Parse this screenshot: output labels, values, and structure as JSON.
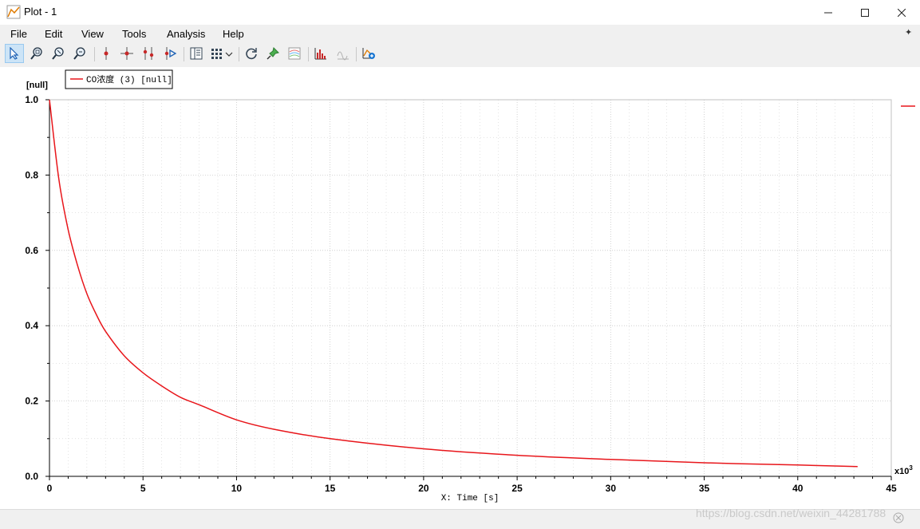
{
  "window": {
    "title": "Plot - 1"
  },
  "menu": {
    "items": [
      "File",
      "Edit",
      "View",
      "Tools",
      "Analysis",
      "Help"
    ]
  },
  "toolbar": {
    "buttons": [
      "select-tool",
      "zoom-region",
      "zoom-in",
      "zoom-out",
      "marker",
      "crosshair",
      "double-marker",
      "marker-play",
      "table-view",
      "grid-options",
      "refresh",
      "pin",
      "layers",
      "histogram",
      "fft-disabled",
      "add-plot"
    ]
  },
  "legend": {
    "label": "CO浓度 (3) [null]"
  },
  "colors": {
    "series": "#e8161b",
    "grid": "#c8c8c8"
  },
  "chart_data": {
    "type": "line",
    "xlabel": "X: Time [s]",
    "ylabel": "[null]",
    "x_multiplier_label": "x10",
    "x_multiplier_exp": "3",
    "xlim": [
      0,
      45
    ],
    "ylim": [
      0,
      1.0
    ],
    "x_ticks": [
      "0",
      "5",
      "10",
      "15",
      "20",
      "25",
      "30",
      "35",
      "40",
      "45"
    ],
    "y_ticks": [
      "0.0",
      "0.2",
      "0.4",
      "0.6",
      "0.8",
      "1.0"
    ],
    "grid": true,
    "legend_position": "top-left",
    "series": [
      {
        "name": "CO浓度 (3) [null]",
        "x": [
          0,
          0.5,
          1,
          1.5,
          2,
          2.5,
          3,
          4,
          5,
          6,
          7,
          8,
          10,
          12,
          15,
          20,
          25,
          30,
          35,
          40,
          43.2
        ],
        "y": [
          1.0,
          0.79,
          0.655,
          0.56,
          0.485,
          0.43,
          0.385,
          0.32,
          0.275,
          0.24,
          0.21,
          0.19,
          0.15,
          0.125,
          0.1,
          0.073,
          0.056,
          0.045,
          0.036,
          0.03,
          0.026
        ]
      }
    ]
  },
  "status": {
    "watermark": "https://blog.csdn.net/weixin_44281788"
  }
}
